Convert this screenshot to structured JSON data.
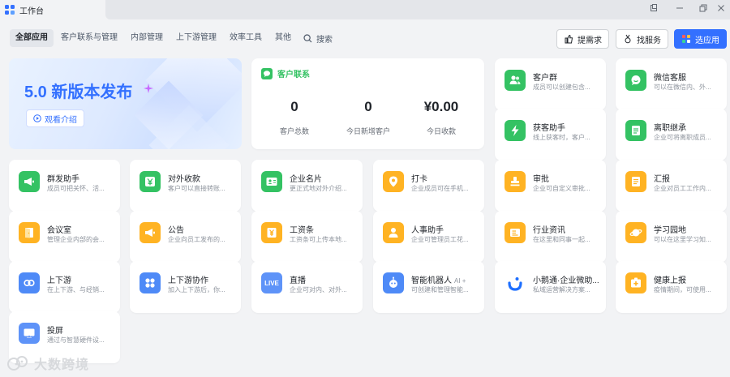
{
  "window": {
    "title": "工作台"
  },
  "nav": {
    "tabs": [
      "全部应用",
      "客户联系与管理",
      "内部管理",
      "上下游管理",
      "效率工具",
      "其他"
    ],
    "search_label": "搜索"
  },
  "actions": {
    "requirement": "提需求",
    "service": "找服务",
    "select_app": "选应用"
  },
  "banner": {
    "title": "5.0 新版本发布",
    "button": "观看介绍"
  },
  "contacts": {
    "title": "客户联系",
    "stats": [
      {
        "value": "0",
        "label": "客户总数"
      },
      {
        "value": "0",
        "label": "今日新增客户"
      },
      {
        "value": "¥0.00",
        "label": "今日收款"
      }
    ]
  },
  "side_apps": [
    {
      "name": "客户群",
      "desc": "成员可以创建包含...",
      "color": "#34c263",
      "icon": "group-icon"
    },
    {
      "name": "微信客服",
      "desc": "可以在微信内、外...",
      "color": "#34c263",
      "icon": "chat-icon"
    },
    {
      "name": "获客助手",
      "desc": "线上获客时，客户...",
      "color": "#34c263",
      "icon": "lightning-icon"
    },
    {
      "name": "离职继承",
      "desc": "企业可将离职成员...",
      "color": "#34c263",
      "icon": "transfer-icon"
    }
  ],
  "apps": [
    {
      "name": "群发助手",
      "desc": "成员可把关怀、活...",
      "color": "#34c263",
      "icon": "megaphone-icon"
    },
    {
      "name": "对外收款",
      "desc": "客户可以直接转账...",
      "color": "#34c263",
      "icon": "yen-icon"
    },
    {
      "name": "企业名片",
      "desc": "更正式地对外介绍...",
      "color": "#34c263",
      "icon": "card-icon"
    },
    {
      "name": "打卡",
      "desc": "企业成员可在手机...",
      "color": "#ffb323",
      "icon": "location-icon"
    },
    {
      "name": "审批",
      "desc": "企业可自定义审批...",
      "color": "#ffb323",
      "icon": "stamp-icon"
    },
    {
      "name": "汇报",
      "desc": "企业对员工工作内...",
      "color": "#ffb323",
      "icon": "report-icon"
    },
    {
      "name": "会议室",
      "desc": "管理企业内部的会...",
      "color": "#ffb323",
      "icon": "door-icon"
    },
    {
      "name": "公告",
      "desc": "企业向员工发布的...",
      "color": "#ffb323",
      "icon": "announce-icon"
    },
    {
      "name": "工资条",
      "desc": "工资条可上传本地...",
      "color": "#ffb323",
      "icon": "payslip-icon"
    },
    {
      "name": "人事助手",
      "desc": "企业可管理员工花...",
      "color": "#ffb323",
      "icon": "person-icon"
    },
    {
      "name": "行业资讯",
      "desc": "在这里和同事一起...",
      "color": "#ffb323",
      "icon": "news-icon"
    },
    {
      "name": "学习园地",
      "desc": "可以在这里学习知...",
      "color": "#ffb323",
      "icon": "planet-icon"
    },
    {
      "name": "上下游",
      "desc": "在上下游、与经销...",
      "color": "#4e8af7",
      "icon": "link-icon"
    },
    {
      "name": "上下游协作",
      "desc": "加入上下游后，你...",
      "color": "#4e8af7",
      "icon": "grid-icon"
    },
    {
      "name": "直播",
      "desc": "企业可对内、对外...",
      "color": "#5e93f8",
      "icon": "live-icon"
    },
    {
      "name": "智能机器人",
      "badge": "AI +",
      "desc": "可创建和管理智能...",
      "color": "#4e8af7",
      "icon": "robot-icon"
    },
    {
      "name": "小鹅通·企业微助...",
      "desc": "私域运营解决方案...",
      "color": "#ffffff",
      "icon": "goose-icon"
    },
    {
      "name": "健康上报",
      "desc": "疫情期间，可使用...",
      "color": "#ffb323",
      "icon": "health-icon"
    },
    {
      "name": "投屏",
      "desc": "通过与智慧硬件设...",
      "color": "#5e93f8",
      "icon": "cast-icon"
    }
  ],
  "watermark": "大数跨境"
}
